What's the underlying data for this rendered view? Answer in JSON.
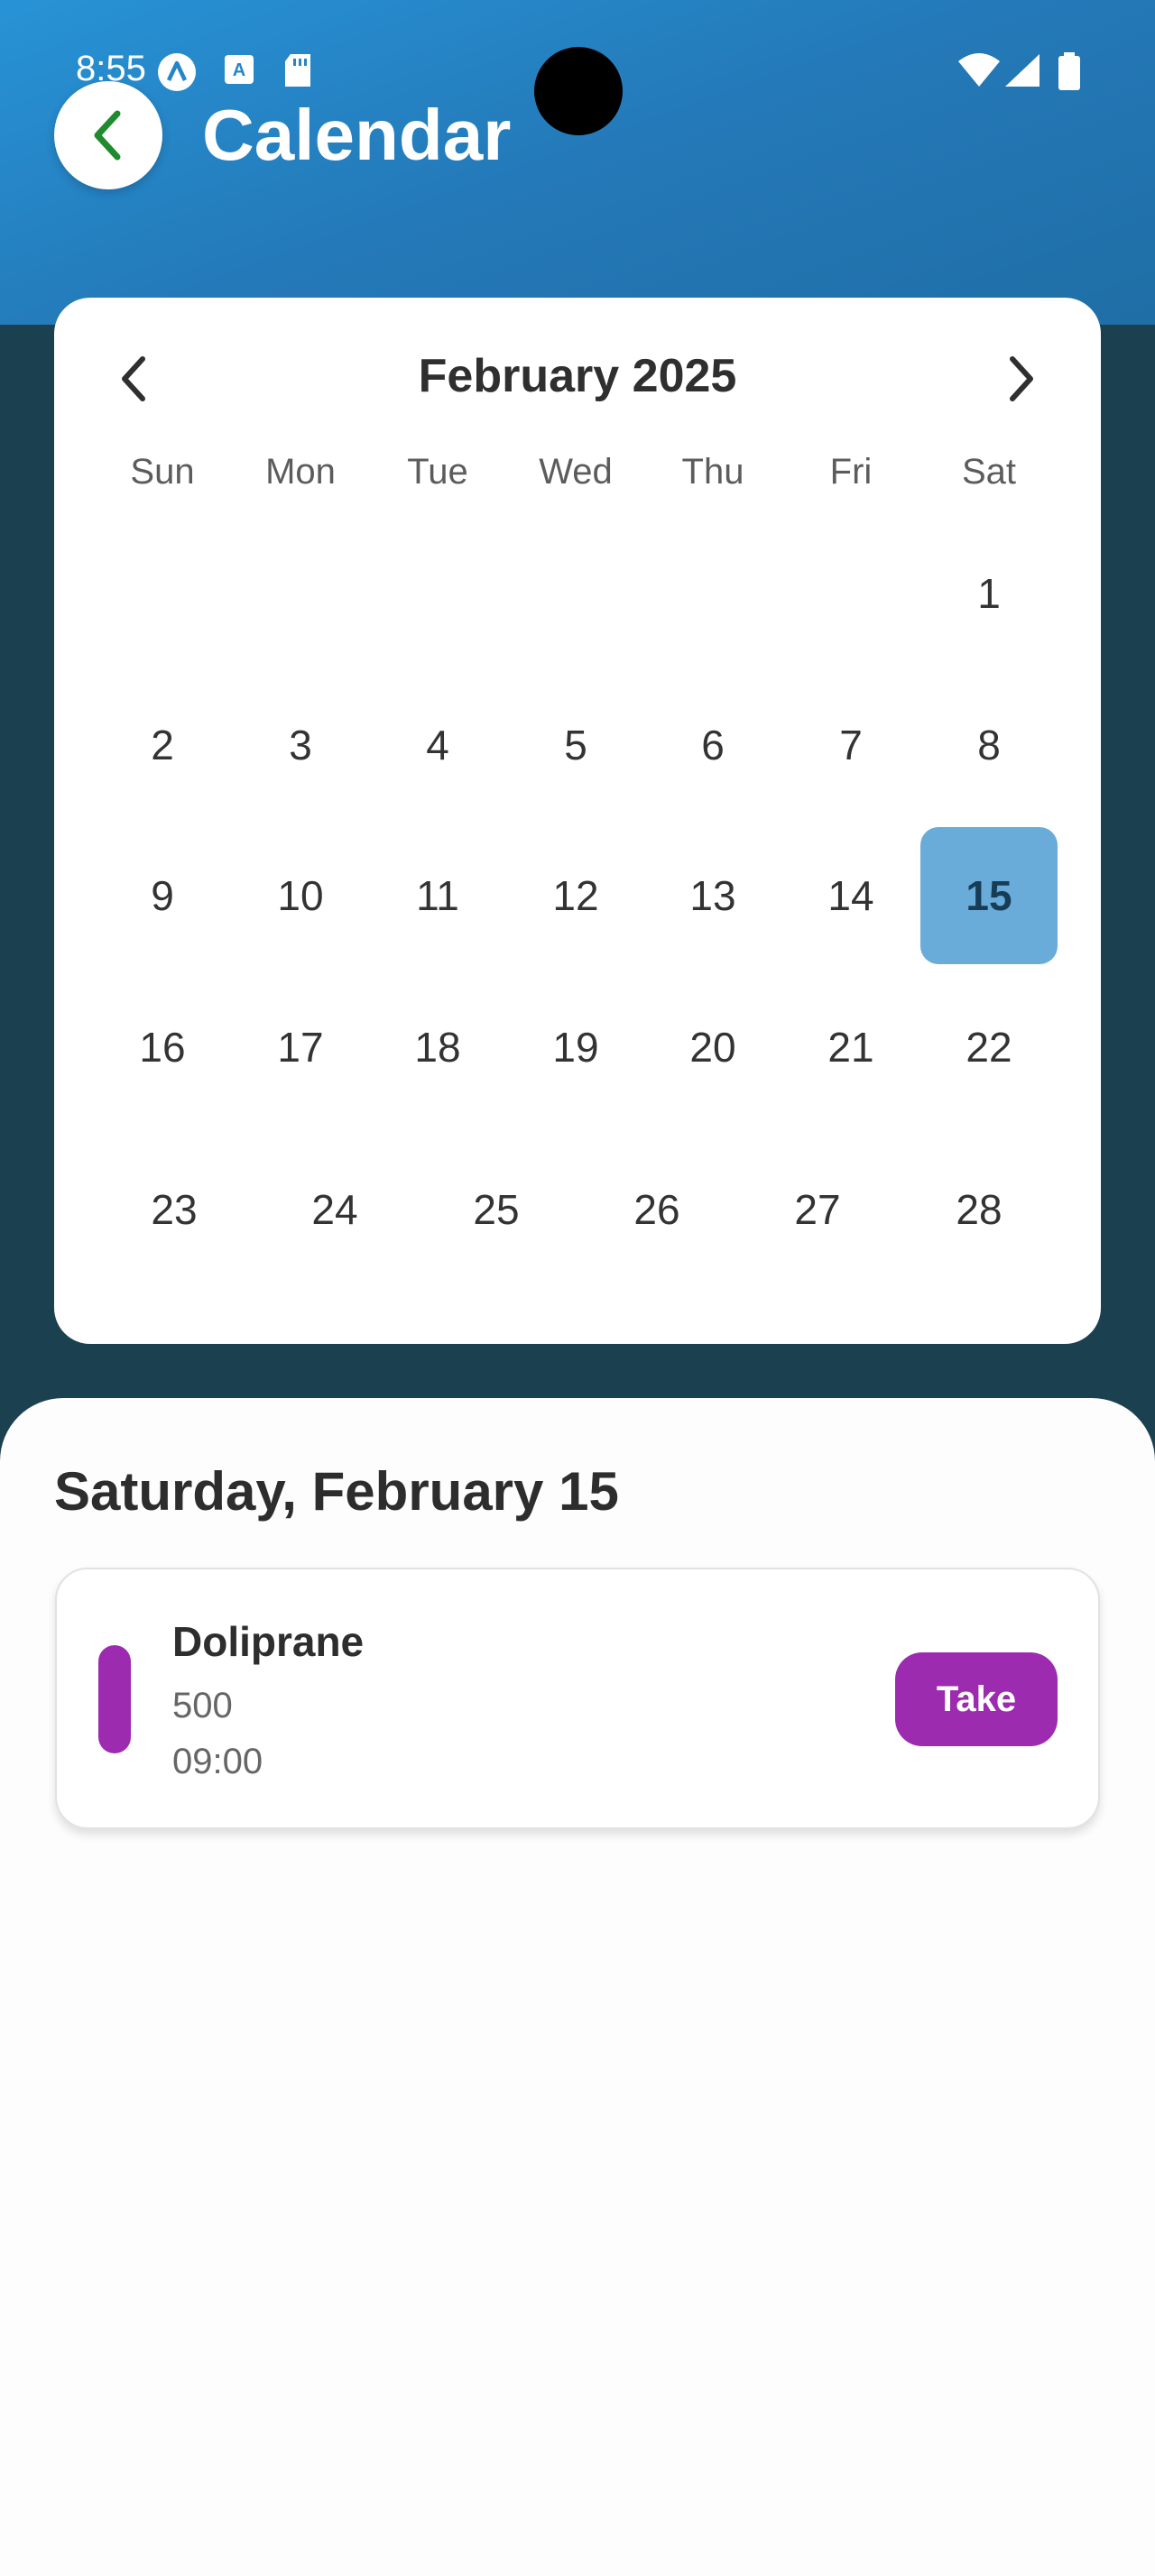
{
  "status_bar": {
    "time": "8:55",
    "left_icons": [
      "app-a-icon",
      "text-a-icon",
      "sd-card-icon"
    ],
    "right_icons": [
      "wifi-icon",
      "cell-signal-icon",
      "battery-icon"
    ]
  },
  "header": {
    "title": "Calendar",
    "back_icon": "chevron-left-icon",
    "back_icon_color": "#1e8c2e"
  },
  "calendar": {
    "month_label": "February 2025",
    "prev_icon": "chevron-left-icon",
    "next_icon": "chevron-right-icon",
    "weekdays": [
      "Sun",
      "Mon",
      "Tue",
      "Wed",
      "Thu",
      "Fri",
      "Sat"
    ],
    "rows": [
      [
        "1"
      ],
      [
        "2",
        "3",
        "4",
        "5",
        "6",
        "7",
        "8"
      ],
      [
        "9",
        "10",
        "11",
        "12",
        "13",
        "14",
        "15"
      ],
      [
        "16",
        "17",
        "18",
        "19",
        "20",
        "21",
        "22"
      ],
      [
        "23",
        "24",
        "25",
        "26",
        "27",
        "28"
      ]
    ],
    "selected_day": "15",
    "selected_color": "#6aacd9"
  },
  "schedule": {
    "date_heading": "Saturday, February 15",
    "items": [
      {
        "name": "Doliprane",
        "dose": "500",
        "time": "09:00",
        "action_label": "Take",
        "accent_color": "#9c2bb0"
      }
    ]
  }
}
